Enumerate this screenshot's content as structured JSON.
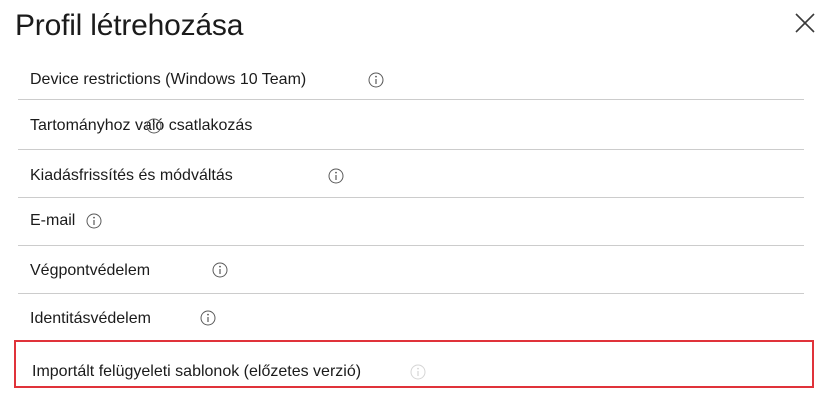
{
  "window": {
    "title": "Profil létrehozása",
    "close_icon": "close-icon"
  },
  "list": {
    "items": [
      {
        "label": "Device restrictions (Windows 10 Team)",
        "icon": "info-icon",
        "partially_visible": true
      },
      {
        "label": "Tartományhoz való csatlakozás",
        "icon": "info-icon"
      },
      {
        "label": "Kiadásfrissítés és módváltás",
        "icon": "info-icon"
      },
      {
        "label": "E-mail",
        "icon": "info-icon"
      },
      {
        "label": "Végpontvédelem",
        "icon": "info-icon"
      },
      {
        "label": "Identitásvédelem",
        "icon": "info-icon"
      },
      {
        "label": "Importált felügyeleti sablonok (előzetes verzió)",
        "icon": "info-icon",
        "highlighted": true
      }
    ]
  },
  "colors": {
    "text": "#1b1b1b",
    "divider": "#cccccc",
    "highlight_border": "#e0333a",
    "icon": "#5a5a5a"
  }
}
